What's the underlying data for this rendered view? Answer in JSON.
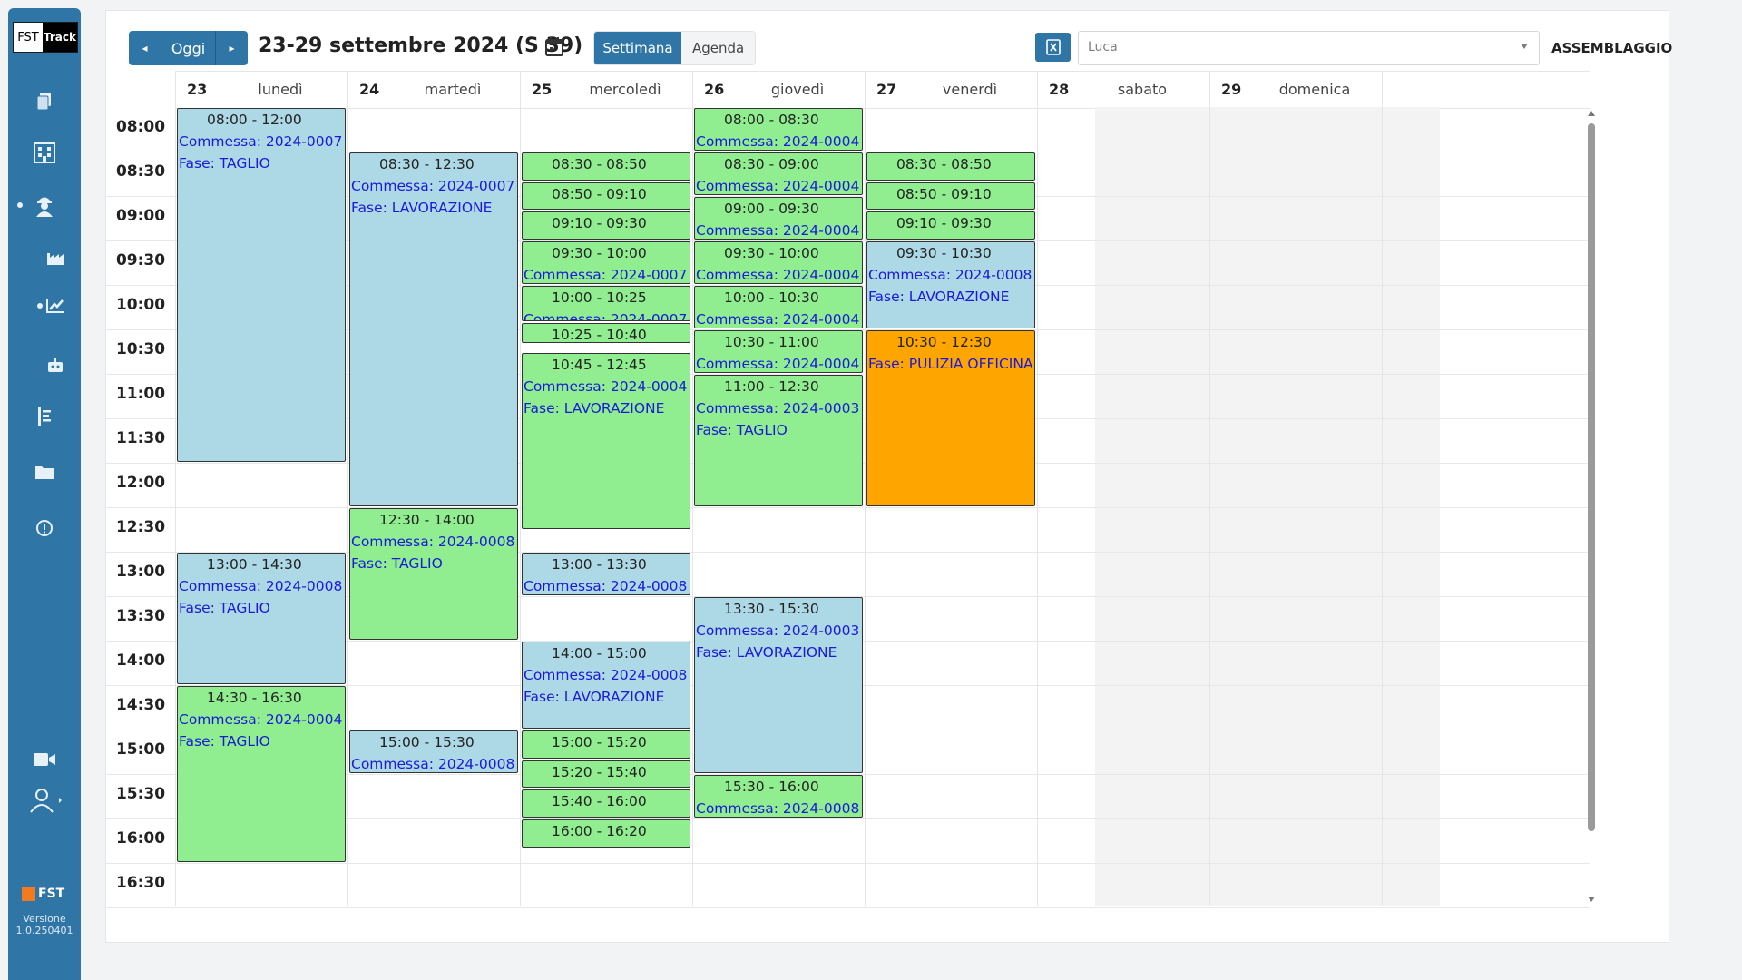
{
  "sidebar": {
    "logo_left": "FST",
    "logo_right": "Track",
    "icons": [
      "documents-icon",
      "building-icon",
      "worker-icon",
      "factory-icon",
      "chart-icon",
      "robot-icon",
      "report-icon",
      "folder-icon",
      "alert-icon",
      "camera-icon",
      "user-icon"
    ],
    "brand": "FST",
    "version_label": "Versione",
    "version_number": "1.0.250401"
  },
  "toolbar": {
    "prev_label": "◂",
    "today_label": "Oggi",
    "next_label": "▸",
    "date_range": "23-29 settembre 2024 (S 39)",
    "view_week": "Settimana",
    "view_agenda": "Agenda",
    "operator_value": "Luca",
    "department": "ASSEMBLAGGIO"
  },
  "days": [
    {
      "num": "23",
      "name": "lunedì"
    },
    {
      "num": "24",
      "name": "martedì"
    },
    {
      "num": "25",
      "name": "mercoledì"
    },
    {
      "num": "26",
      "name": "giovedì"
    },
    {
      "num": "27",
      "name": "venerdì"
    },
    {
      "num": "28",
      "name": "sabato"
    },
    {
      "num": "29",
      "name": "domenica"
    }
  ],
  "time_labels": [
    "08:00",
    "08:30",
    "09:00",
    "09:30",
    "10:00",
    "10:30",
    "11:00",
    "11:30",
    "12:00",
    "12:30",
    "13:00",
    "13:30",
    "14:00",
    "14:30",
    "15:00",
    "15:30",
    "16:00",
    "16:30"
  ],
  "colors": {
    "green": "#90ee90",
    "blue": "#add8e6",
    "orange": "#ffa500",
    "accent": "#2f75a6"
  },
  "events": [
    {
      "day": 0,
      "start": "08:00",
      "end": "12:00",
      "color": "blue",
      "time": "08:00 - 12:00",
      "commessa": "Commessa: 2024-0007",
      "fase": "Fase: TAGLIO"
    },
    {
      "day": 0,
      "start": "13:00",
      "end": "14:30",
      "color": "blue",
      "time": "13:00 - 14:30",
      "commessa": "Commessa: 2024-0008",
      "fase": "Fase: TAGLIO"
    },
    {
      "day": 0,
      "start": "14:30",
      "end": "16:30",
      "color": "green",
      "time": "14:30 - 16:30",
      "commessa": "Commessa: 2024-0004",
      "fase": "Fase: TAGLIO"
    },
    {
      "day": 1,
      "start": "08:30",
      "end": "12:30",
      "color": "blue",
      "time": "08:30 - 12:30",
      "commessa": "Commessa: 2024-0007",
      "fase": "Fase: LAVORAZIONE"
    },
    {
      "day": 1,
      "start": "12:30",
      "end": "14:00",
      "color": "green",
      "time": "12:30 - 14:00",
      "commessa": "Commessa: 2024-0008",
      "fase": "Fase: TAGLIO"
    },
    {
      "day": 1,
      "start": "15:00",
      "end": "15:30",
      "color": "blue",
      "time": "15:00 - 15:30",
      "commessa": "Commessa: 2024-0008",
      "fase": ""
    },
    {
      "day": 2,
      "start": "08:30",
      "end": "08:50",
      "color": "green",
      "time": "08:30 - 08:50",
      "commessa": "",
      "fase": ""
    },
    {
      "day": 2,
      "start": "08:50",
      "end": "09:10",
      "color": "green",
      "time": "08:50 - 09:10",
      "commessa": "",
      "fase": ""
    },
    {
      "day": 2,
      "start": "09:10",
      "end": "09:30",
      "color": "green",
      "time": "09:10 - 09:30",
      "commessa": "",
      "fase": ""
    },
    {
      "day": 2,
      "start": "09:30",
      "end": "10:00",
      "color": "green",
      "time": "09:30 - 10:00",
      "commessa": "Commessa: 2024-0007",
      "fase": ""
    },
    {
      "day": 2,
      "start": "10:00",
      "end": "10:25",
      "color": "green",
      "time": "10:00 - 10:25",
      "commessa": "Commessa: 2024-0007",
      "fase": ""
    },
    {
      "day": 2,
      "start": "10:25",
      "end": "10:40",
      "color": "green",
      "time": "10:25 - 10:40",
      "commessa": "",
      "fase": ""
    },
    {
      "day": 2,
      "start": "10:45",
      "end": "12:45",
      "color": "green",
      "time": "10:45 - 12:45",
      "commessa": "Commessa: 2024-0004",
      "fase": "Fase: LAVORAZIONE"
    },
    {
      "day": 2,
      "start": "13:00",
      "end": "13:30",
      "color": "blue",
      "time": "13:00 - 13:30",
      "commessa": "Commessa: 2024-0008",
      "fase": ""
    },
    {
      "day": 2,
      "start": "14:00",
      "end": "15:00",
      "color": "blue",
      "time": "14:00 - 15:00",
      "commessa": "Commessa: 2024-0008",
      "fase": "Fase: LAVORAZIONE"
    },
    {
      "day": 2,
      "start": "15:00",
      "end": "15:20",
      "color": "green",
      "time": "15:00 - 15:20",
      "commessa": "",
      "fase": ""
    },
    {
      "day": 2,
      "start": "15:20",
      "end": "15:40",
      "color": "green",
      "time": "15:20 - 15:40",
      "commessa": "",
      "fase": ""
    },
    {
      "day": 2,
      "start": "15:40",
      "end": "16:00",
      "color": "green",
      "time": "15:40 - 16:00",
      "commessa": "",
      "fase": ""
    },
    {
      "day": 2,
      "start": "16:00",
      "end": "16:20",
      "color": "green",
      "time": "16:00 - 16:20",
      "commessa": "",
      "fase": ""
    },
    {
      "day": 3,
      "start": "08:00",
      "end": "08:30",
      "color": "green",
      "time": "08:00 - 08:30",
      "commessa": "Commessa: 2024-0004",
      "fase": ""
    },
    {
      "day": 3,
      "start": "08:30",
      "end": "09:00",
      "color": "green",
      "time": "08:30 - 09:00",
      "commessa": "Commessa: 2024-0004",
      "fase": ""
    },
    {
      "day": 3,
      "start": "09:00",
      "end": "09:30",
      "color": "green",
      "time": "09:00 - 09:30",
      "commessa": "Commessa: 2024-0004",
      "fase": ""
    },
    {
      "day": 3,
      "start": "09:30",
      "end": "10:00",
      "color": "green",
      "time": "09:30 - 10:00",
      "commessa": "Commessa: 2024-0004",
      "fase": ""
    },
    {
      "day": 3,
      "start": "10:00",
      "end": "10:30",
      "color": "green",
      "time": "10:00 - 10:30",
      "commessa": "Commessa: 2024-0004",
      "fase": ""
    },
    {
      "day": 3,
      "start": "10:30",
      "end": "11:00",
      "color": "green",
      "time": "10:30 - 11:00",
      "commessa": "Commessa: 2024-0004",
      "fase": ""
    },
    {
      "day": 3,
      "start": "11:00",
      "end": "12:30",
      "color": "green",
      "time": "11:00 - 12:30",
      "commessa": "Commessa: 2024-0003",
      "fase": "Fase: TAGLIO"
    },
    {
      "day": 3,
      "start": "13:30",
      "end": "15:30",
      "color": "blue",
      "time": "13:30 - 15:30",
      "commessa": "Commessa: 2024-0003",
      "fase": "Fase: LAVORAZIONE"
    },
    {
      "day": 3,
      "start": "15:30",
      "end": "16:00",
      "color": "green",
      "time": "15:30 - 16:00",
      "commessa": "Commessa: 2024-0008",
      "fase": ""
    },
    {
      "day": 4,
      "start": "08:30",
      "end": "08:50",
      "color": "green",
      "time": "08:30 - 08:50",
      "commessa": "",
      "fase": ""
    },
    {
      "day": 4,
      "start": "08:50",
      "end": "09:10",
      "color": "green",
      "time": "08:50 - 09:10",
      "commessa": "",
      "fase": ""
    },
    {
      "day": 4,
      "start": "09:10",
      "end": "09:30",
      "color": "green",
      "time": "09:10 - 09:30",
      "commessa": "",
      "fase": ""
    },
    {
      "day": 4,
      "start": "09:30",
      "end": "10:30",
      "color": "blue",
      "time": "09:30 - 10:30",
      "commessa": "Commessa: 2024-0008",
      "fase": "Fase: LAVORAZIONE"
    },
    {
      "day": 4,
      "start": "10:30",
      "end": "12:30",
      "color": "orange",
      "time": "10:30 - 12:30",
      "commessa": "",
      "fase": "Fase: PULIZIA OFFICINA"
    }
  ]
}
